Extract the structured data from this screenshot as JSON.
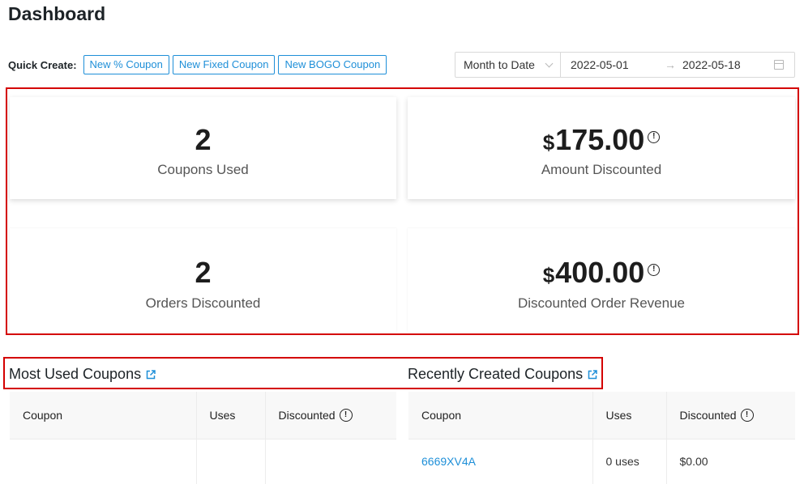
{
  "page_title": "Dashboard",
  "quick_create": {
    "label": "Quick Create:",
    "buttons": [
      "New % Coupon",
      "New Fixed Coupon",
      "New BOGO Coupon"
    ]
  },
  "date_filter": {
    "range_option": "Month to Date",
    "start_date": "2022-05-01",
    "end_date": "2022-05-18",
    "arrow": "→"
  },
  "stats": {
    "coupons_used": {
      "value": "2",
      "label": "Coupons Used"
    },
    "amount_discounted": {
      "currency": "$",
      "value": "175.00",
      "label": "Amount Discounted"
    },
    "orders_discounted": {
      "value": "2",
      "label": "Orders Discounted"
    },
    "discounted_order_revenue": {
      "currency": "$",
      "value": "400.00",
      "label": "Discounted Order Revenue"
    }
  },
  "most_used": {
    "title": "Most Used Coupons",
    "columns": [
      "Coupon",
      "Uses",
      "Discounted"
    ],
    "rows": []
  },
  "recently_created": {
    "title": "Recently Created Coupons",
    "columns": [
      "Coupon",
      "Uses",
      "Discounted"
    ],
    "rows": [
      {
        "coupon": "6669XV4A",
        "uses": "0 uses",
        "discounted": "$0.00"
      }
    ]
  },
  "colors": {
    "accent": "#1e8fd8",
    "highlight": "#d40000"
  }
}
